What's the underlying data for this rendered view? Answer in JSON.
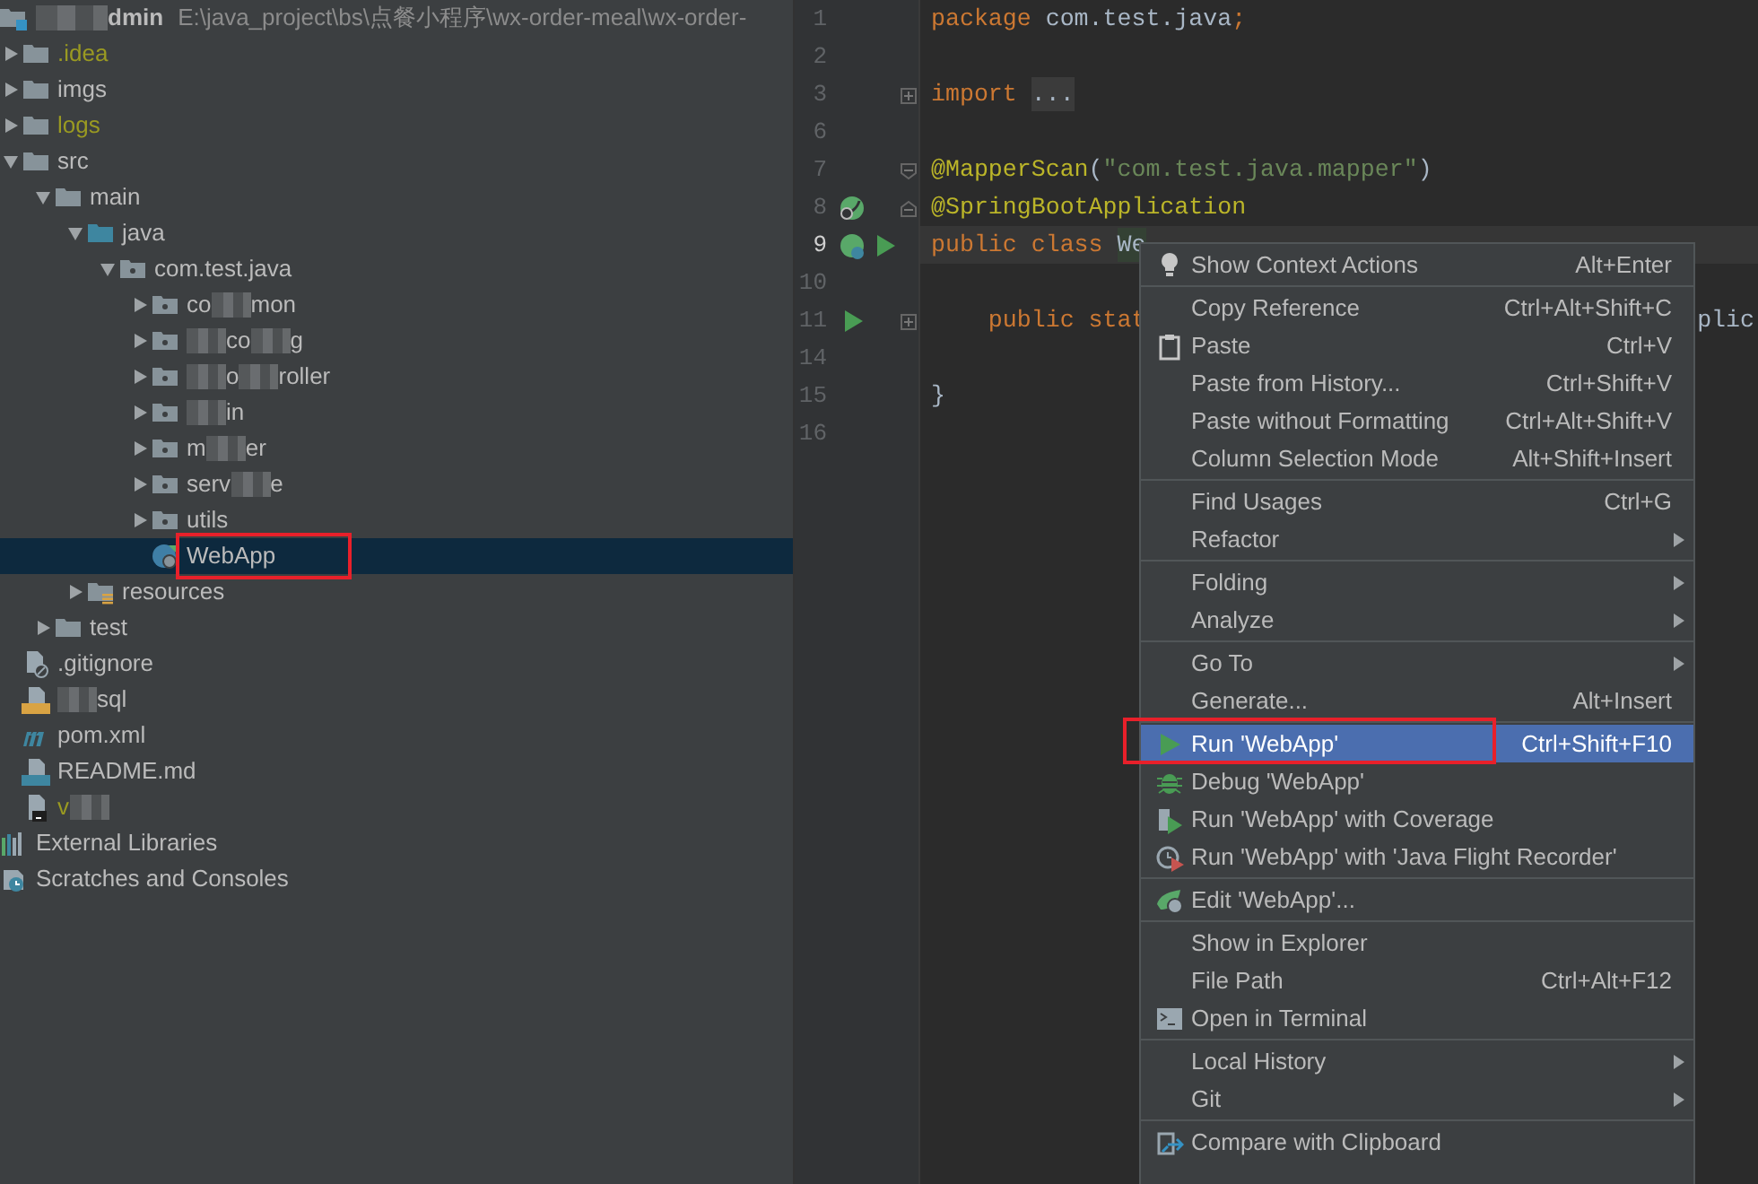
{
  "project": {
    "segments": [
      {
        "kind": "mask"
      },
      {
        "kind": "text",
        "text": "dmin"
      }
    ],
    "path": "E:\\java_project\\bs\\点餐小程序\\wx-order-meal\\wx-order-"
  },
  "tree": [
    {
      "kind": "folder",
      "segments": [
        {
          "kind": "text",
          "text": ".idea"
        }
      ],
      "ignored": true,
      "expanded": false,
      "selected": false
    },
    {
      "kind": "folder",
      "segments": [
        {
          "kind": "text",
          "text": "imgs"
        }
      ],
      "ignored": false,
      "expanded": false,
      "selected": false
    },
    {
      "kind": "folder",
      "segments": [
        {
          "kind": "text",
          "text": "logs"
        }
      ],
      "ignored": true,
      "expanded": false,
      "selected": false
    },
    {
      "kind": "folder",
      "segments": [
        {
          "kind": "text",
          "text": "src"
        }
      ],
      "ignored": false,
      "expanded": true,
      "selected": false,
      "children": [
        {
          "kind": "folder",
          "segments": [
            {
              "kind": "text",
              "text": "main"
            }
          ],
          "ignored": false,
          "expanded": true,
          "selected": false,
          "children": [
            {
              "kind": "source",
              "segments": [
                {
                  "kind": "text",
                  "text": "java"
                }
              ],
              "ignored": false,
              "expanded": true,
              "selected": false,
              "children": [
                {
                  "kind": "package",
                  "segments": [
                    {
                      "kind": "text",
                      "text": "com.test.java"
                    }
                  ],
                  "ignored": false,
                  "expanded": true,
                  "selected": false,
                  "children": [
                    {
                      "kind": "package",
                      "segments": [
                        {
                          "kind": "text",
                          "text": "co"
                        },
                        {
                          "kind": "mask"
                        },
                        {
                          "kind": "text",
                          "text": "mon"
                        }
                      ],
                      "ignored": false,
                      "expanded": false,
                      "selected": false
                    },
                    {
                      "kind": "package",
                      "segments": [
                        {
                          "kind": "mask"
                        },
                        {
                          "kind": "text",
                          "text": "co"
                        },
                        {
                          "kind": "mask"
                        },
                        {
                          "kind": "text",
                          "text": "g"
                        }
                      ],
                      "ignored": false,
                      "expanded": false,
                      "selected": false
                    },
                    {
                      "kind": "package",
                      "segments": [
                        {
                          "kind": "mask"
                        },
                        {
                          "kind": "text",
                          "text": "o"
                        },
                        {
                          "kind": "mask"
                        },
                        {
                          "kind": "text",
                          "text": "roller"
                        }
                      ],
                      "ignored": false,
                      "expanded": false,
                      "selected": false
                    },
                    {
                      "kind": "package",
                      "segments": [
                        {
                          "kind": "mask"
                        },
                        {
                          "kind": "text",
                          "text": "in"
                        }
                      ],
                      "ignored": false,
                      "expanded": false,
                      "selected": false
                    },
                    {
                      "kind": "package",
                      "segments": [
                        {
                          "kind": "text",
                          "text": "m"
                        },
                        {
                          "kind": "mask"
                        },
                        {
                          "kind": "text",
                          "text": "er"
                        }
                      ],
                      "ignored": false,
                      "expanded": false,
                      "selected": false
                    },
                    {
                      "kind": "package",
                      "segments": [
                        {
                          "kind": "text",
                          "text": "serv"
                        },
                        {
                          "kind": "mask"
                        },
                        {
                          "kind": "text",
                          "text": "e"
                        }
                      ],
                      "ignored": false,
                      "expanded": false,
                      "selected": false
                    },
                    {
                      "kind": "package",
                      "segments": [
                        {
                          "kind": "text",
                          "text": "utils"
                        }
                      ],
                      "ignored": false,
                      "expanded": false,
                      "selected": false
                    },
                    {
                      "kind": "class",
                      "segments": [
                        {
                          "kind": "text",
                          "text": "WebApp"
                        }
                      ],
                      "ignored": false,
                      "selected": true,
                      "annotated": true
                    }
                  ]
                }
              ]
            },
            {
              "kind": "resources",
              "segments": [
                {
                  "kind": "text",
                  "text": "resources"
                }
              ],
              "ignored": false,
              "expanded": false,
              "selected": false
            }
          ]
        },
        {
          "kind": "folder",
          "segments": [
            {
              "kind": "text",
              "text": "test"
            }
          ],
          "ignored": false,
          "expanded": false,
          "selected": false
        }
      ]
    },
    {
      "kind": "gitignore",
      "segments": [
        {
          "kind": "text",
          "text": ".gitignore"
        }
      ],
      "ignored": false,
      "selected": false
    },
    {
      "kind": "sql",
      "segments": [
        {
          "kind": "mask"
        },
        {
          "kind": "text",
          "text": "sql"
        }
      ],
      "ignored": false,
      "selected": false
    },
    {
      "kind": "maven",
      "segments": [
        {
          "kind": "text",
          "text": "pom.xml"
        }
      ],
      "ignored": false,
      "selected": false
    },
    {
      "kind": "markdown",
      "segments": [
        {
          "kind": "text",
          "text": "README.md"
        }
      ],
      "ignored": false,
      "selected": false
    },
    {
      "kind": "shell",
      "segments": [
        {
          "kind": "text",
          "text": "v"
        },
        {
          "kind": "mask"
        }
      ],
      "ignored": true,
      "selected": false
    }
  ],
  "extra_nodes": [
    {
      "kind": "libraries",
      "label": "External Libraries"
    },
    {
      "kind": "scratches",
      "label": "Scratches and Consoles"
    }
  ],
  "editor": {
    "lines": [
      {
        "number": "1",
        "tokens": [
          {
            "kind": "keyword",
            "text": "package"
          },
          {
            "kind": "plain",
            "text": " com.test.java"
          },
          {
            "kind": "keyword",
            "text": ";"
          }
        ]
      },
      {
        "number": "2"
      },
      {
        "number": "3",
        "fold_marker": {
          "kind": "expand"
        },
        "tokens": [
          {
            "kind": "keyword",
            "text": "import "
          },
          {
            "kind": "folded",
            "text": "..."
          }
        ]
      },
      {
        "number": "6"
      },
      {
        "number": "7",
        "fold_marker": {
          "kind": "start"
        },
        "tokens": [
          {
            "kind": "annotation",
            "text": "@MapperScan"
          },
          {
            "kind": "plain",
            "text": "("
          },
          {
            "kind": "string",
            "text": "\"com.test.java.mapper\""
          },
          {
            "kind": "plain",
            "text": ")"
          }
        ]
      },
      {
        "number": "8",
        "gutter_icons": [
          {
            "kind": "bean"
          }
        ],
        "fold_marker": {
          "kind": "end"
        },
        "tokens": [
          {
            "kind": "annotation",
            "text": "@SpringBootApplication"
          }
        ]
      },
      {
        "number": "9",
        "current": true,
        "gutter_icons": [
          {
            "kind": "bean-run"
          },
          {
            "kind": "run"
          }
        ],
        "tokens": [
          {
            "kind": "keyword",
            "text": "public class "
          },
          {
            "kind": "usage",
            "text": "We"
          }
        ]
      },
      {
        "number": "10"
      },
      {
        "number": "11",
        "gutter_icons": [
          {
            "kind": "run"
          }
        ],
        "fold_marker": {
          "kind": "expand"
        },
        "tokens": [
          {
            "kind": "keyword",
            "text": "    public stat"
          },
          {
            "kind": "tail",
            "text": "plic"
          }
        ]
      },
      {
        "number": "14"
      },
      {
        "number": "15",
        "tokens": [
          {
            "kind": "plain",
            "text": "}"
          }
        ]
      },
      {
        "number": "16"
      }
    ]
  },
  "context_menu": {
    "groups": [
      [
        {
          "kind": "bulb",
          "label": "Show Context Actions",
          "shortcut": "Alt+Enter",
          "selected": false
        }
      ],
      [
        {
          "label": "Copy Reference",
          "shortcut": "Ctrl+Alt+Shift+C",
          "selected": false
        },
        {
          "kind": "clipboard",
          "label": "Paste",
          "shortcut": "Ctrl+V",
          "selected": false
        },
        {
          "label": "Paste from History...",
          "shortcut": "Ctrl+Shift+V",
          "selected": false
        },
        {
          "label": "Paste without Formatting",
          "shortcut": "Ctrl+Alt+Shift+V",
          "selected": false
        },
        {
          "label": "Column Selection Mode",
          "shortcut": "Alt+Shift+Insert",
          "selected": false
        }
      ],
      [
        {
          "label": "Find Usages",
          "shortcut": "Ctrl+G",
          "selected": false
        },
        {
          "label": "Refactor",
          "submenu": true,
          "selected": false
        }
      ],
      [
        {
          "label": "Folding",
          "submenu": true,
          "selected": false
        },
        {
          "label": "Analyze",
          "submenu": true,
          "selected": false
        }
      ],
      [
        {
          "label": "Go To",
          "submenu": true,
          "selected": false
        },
        {
          "label": "Generate...",
          "shortcut": "Alt+Insert",
          "selected": false
        }
      ],
      [
        {
          "kind": "run",
          "label": "Run 'WebApp'",
          "shortcut": "Ctrl+Shift+F10",
          "selected": true,
          "annotated": true
        },
        {
          "kind": "debug",
          "label": "Debug 'WebApp'",
          "selected": false
        },
        {
          "kind": "coverage",
          "label": "Run 'WebApp' with Coverage",
          "selected": false
        },
        {
          "kind": "recorder",
          "label": "Run 'WebApp' with 'Java Flight Recorder'",
          "selected": false
        }
      ],
      [
        {
          "kind": "edit-config",
          "label": "Edit 'WebApp'...",
          "selected": false
        }
      ],
      [
        {
          "label": "Show in Explorer",
          "selected": false
        },
        {
          "label": "File Path",
          "shortcut": "Ctrl+Alt+F12",
          "selected": false
        },
        {
          "kind": "terminal",
          "label": "Open in Terminal",
          "selected": false
        }
      ],
      [
        {
          "label": "Local History",
          "submenu": true,
          "selected": false
        },
        {
          "label": "Git",
          "submenu": true,
          "selected": false
        }
      ],
      [
        {
          "kind": "compare",
          "label": "Compare with Clipboard",
          "selected": false
        }
      ]
    ]
  }
}
